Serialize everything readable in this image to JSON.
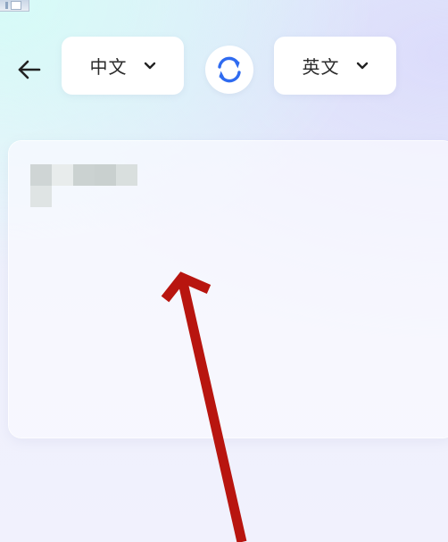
{
  "header": {
    "back_icon": "arrow-left-icon",
    "source_language": {
      "label": "中文",
      "icon": "chevron-down-icon"
    },
    "swap_icon": "swap-refresh-icon",
    "target_language": {
      "label": "英文",
      "icon": "chevron-down-icon"
    }
  },
  "input_card": {
    "text": "",
    "redacted": true
  },
  "annotation": {
    "type": "arrow",
    "color": "#b8150f"
  },
  "colors": {
    "swap_icon": "#2f6bf0",
    "text": "#2a2a2a",
    "card": "#fafaff",
    "arrow": "#b8150f"
  }
}
